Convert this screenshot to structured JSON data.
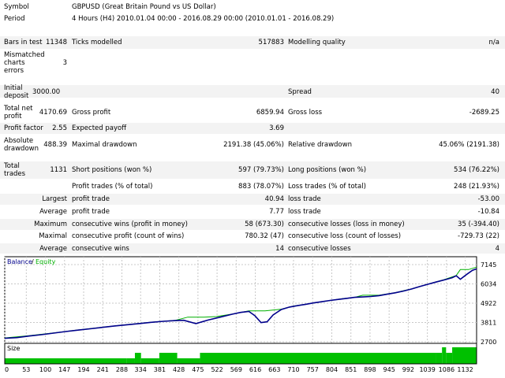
{
  "report": {
    "symbol_label": "Symbol",
    "symbol_value": "GBPUSD (Great Britain Pound vs US Dollar)",
    "period_label": "Period",
    "period_value": "4 Hours (H4) 2010.01.04 00:00 - 2016.08.29 00:00 (2010.01.01 - 2016.08.29)",
    "bars_label": "Bars in test",
    "bars_value": "11348",
    "ticks_label": "Ticks modelled",
    "ticks_value": "517883",
    "quality_label": "Modelling quality",
    "quality_value": "n/a",
    "mismatch_label_1": "Mismatched",
    "mismatch_label_2": "charts",
    "mismatch_label_3": "errors",
    "mismatch_value": "3",
    "deposit_label_1": "Initial",
    "deposit_label_2": "deposit",
    "deposit_value": "3000.00",
    "spread_label": "Spread",
    "spread_value": "40",
    "netprofit_label_1": "Total net",
    "netprofit_label_2": "profit",
    "netprofit_value": "4170.69",
    "grossprofit_label": "Gross profit",
    "grossprofit_value": "6859.94",
    "grossloss_label": "Gross loss",
    "grossloss_value": "-2689.25",
    "pf_label": "Profit factor",
    "pf_value": "2.55",
    "payoff_label": "Expected payoff",
    "payoff_value": "3.69",
    "absdd_label_1": "Absolute",
    "absdd_label_2": "drawdown",
    "absdd_value": "488.39",
    "maxdd_label": "Maximal drawdown",
    "maxdd_value": "2191.38 (45.06%)",
    "reldd_label": "Relative drawdown",
    "reldd_value": "45.06% (2191.38)",
    "trades_label_1": "Total",
    "trades_label_2": "trades",
    "trades_value": "1131",
    "short_label": "Short positions (won %)",
    "short_value": "597 (79.73%)",
    "long_label": "Long positions (won %)",
    "long_value": "534 (76.22%)",
    "profit_trades_label": "Profit trades (% of total)",
    "profit_trades_value": "883 (78.07%)",
    "loss_trades_label": "Loss trades (% of total)",
    "loss_trades_value": "248 (21.93%)",
    "largest_label": "Largest",
    "largest_profit_label": "profit trade",
    "largest_profit_value": "40.94",
    "largest_loss_label": "loss trade",
    "largest_loss_value": "-53.00",
    "average_label": "Average",
    "average_profit_label": "profit trade",
    "average_profit_value": "7.77",
    "average_loss_label": "loss trade",
    "average_loss_value": "-10.84",
    "maximum_label": "Maximum",
    "max_wins_label": "consecutive wins (profit in money)",
    "max_wins_value": "58 (673.30)",
    "max_losses_label": "consecutive losses (loss in money)",
    "max_losses_value": "35 (-394.40)",
    "maximal_label": "Maximal",
    "maximal_profit_label": "consecutive profit (count of wins)",
    "maximal_profit_value": "780.32 (47)",
    "maximal_loss_label": "consecutive loss (count of losses)",
    "maximal_loss_value": "-729.73 (22)",
    "average2_label": "Average",
    "avg_wins_label": "consecutive wins",
    "avg_wins_value": "14",
    "avg_losses_label": "consecutive losses",
    "avg_losses_value": "4"
  },
  "chart_data": {
    "type": "line",
    "legend": [
      "Balance",
      "Equity"
    ],
    "legend_separator": "/",
    "size_label": "Size",
    "colors": {
      "balance": "#00008b",
      "equity": "#00b000",
      "size": "#00c000",
      "grid": "#c8c8c8"
    },
    "y_ticks": [
      "7145",
      "6034",
      "4922",
      "3811",
      "2700"
    ],
    "ylim": [
      2700,
      7145
    ],
    "x_ticks": [
      "0",
      "53",
      "100",
      "147",
      "194",
      "241",
      "288",
      "334",
      "381",
      "428",
      "475",
      "522",
      "569",
      "616",
      "663",
      "710",
      "757",
      "804",
      "851",
      "898",
      "945",
      "992",
      "1039",
      "1086",
      "1132"
    ],
    "xlim": [
      0,
      1160
    ],
    "balance": [
      [
        0,
        2900
      ],
      [
        30,
        2940
      ],
      [
        60,
        3030
      ],
      [
        90,
        3110
      ],
      [
        120,
        3200
      ],
      [
        150,
        3290
      ],
      [
        180,
        3370
      ],
      [
        210,
        3450
      ],
      [
        240,
        3530
      ],
      [
        270,
        3610
      ],
      [
        300,
        3680
      ],
      [
        330,
        3750
      ],
      [
        360,
        3820
      ],
      [
        390,
        3880
      ],
      [
        420,
        3920
      ],
      [
        440,
        3940
      ],
      [
        470,
        3750
      ],
      [
        500,
        3950
      ],
      [
        530,
        4120
      ],
      [
        560,
        4290
      ],
      [
        580,
        4390
      ],
      [
        600,
        4450
      ],
      [
        615,
        4200
      ],
      [
        630,
        3800
      ],
      [
        645,
        3850
      ],
      [
        660,
        4250
      ],
      [
        680,
        4560
      ],
      [
        700,
        4700
      ],
      [
        720,
        4780
      ],
      [
        740,
        4860
      ],
      [
        760,
        4940
      ],
      [
        780,
        5010
      ],
      [
        800,
        5080
      ],
      [
        820,
        5140
      ],
      [
        840,
        5200
      ],
      [
        860,
        5260
      ],
      [
        880,
        5280
      ],
      [
        900,
        5310
      ],
      [
        920,
        5360
      ],
      [
        940,
        5440
      ],
      [
        960,
        5520
      ],
      [
        980,
        5620
      ],
      [
        1000,
        5740
      ],
      [
        1020,
        5880
      ],
      [
        1040,
        6010
      ],
      [
        1060,
        6140
      ],
      [
        1080,
        6260
      ],
      [
        1100,
        6390
      ],
      [
        1110,
        6500
      ],
      [
        1120,
        6300
      ],
      [
        1135,
        6570
      ],
      [
        1150,
        6820
      ],
      [
        1160,
        6900
      ]
    ],
    "equity": [
      [
        0,
        2920
      ],
      [
        60,
        3050
      ],
      [
        120,
        3210
      ],
      [
        180,
        3380
      ],
      [
        240,
        3540
      ],
      [
        300,
        3690
      ],
      [
        360,
        3830
      ],
      [
        420,
        3940
      ],
      [
        450,
        4120
      ],
      [
        490,
        4120
      ],
      [
        520,
        4150
      ],
      [
        560,
        4300
      ],
      [
        600,
        4480
      ],
      [
        640,
        4480
      ],
      [
        680,
        4580
      ],
      [
        710,
        4760
      ],
      [
        750,
        4900
      ],
      [
        790,
        5040
      ],
      [
        830,
        5180
      ],
      [
        860,
        5260
      ],
      [
        880,
        5380
      ],
      [
        920,
        5380
      ],
      [
        960,
        5530
      ],
      [
        1000,
        5750
      ],
      [
        1040,
        6020
      ],
      [
        1080,
        6280
      ],
      [
        1110,
        6520
      ],
      [
        1120,
        6860
      ],
      [
        1140,
        6860
      ],
      [
        1160,
        7000
      ]
    ],
    "size_bars": [
      [
        0,
        1
      ],
      [
        300,
        1
      ],
      [
        320,
        2
      ],
      [
        335,
        1
      ],
      [
        380,
        2
      ],
      [
        424,
        1
      ],
      [
        480,
        2
      ],
      [
        1060,
        2
      ],
      [
        1075,
        3
      ],
      [
        1085,
        2
      ],
      [
        1100,
        3
      ],
      [
        1160,
        3
      ]
    ]
  }
}
